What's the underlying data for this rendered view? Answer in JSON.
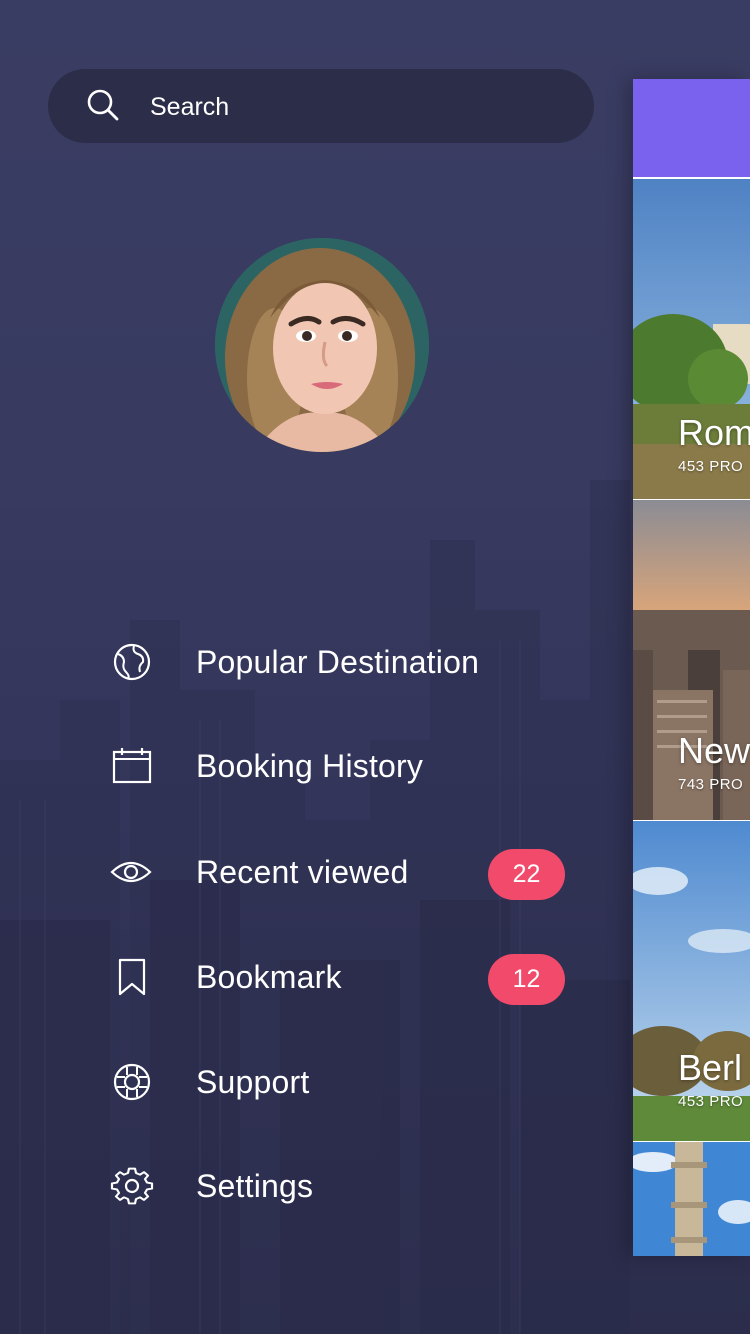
{
  "search": {
    "placeholder": "Search",
    "icon": "search-icon"
  },
  "profile": {
    "avatar_icon": "avatar"
  },
  "menu": {
    "items": [
      {
        "label": "Popular Destination",
        "icon": "globe-icon"
      },
      {
        "label": "Booking History",
        "icon": "calendar-icon"
      },
      {
        "label": "Recent viewed",
        "icon": "eye-icon",
        "badge": "22"
      },
      {
        "label": "Bookmark",
        "icon": "bookmark-icon",
        "badge": "12"
      },
      {
        "label": "Support",
        "icon": "lifebuoy-icon"
      },
      {
        "label": "Settings",
        "icon": "gear-icon"
      }
    ]
  },
  "preview": {
    "header_color": "#7a62ee",
    "cards": [
      {
        "title": "Rom",
        "subtitle": "453 PRO"
      },
      {
        "title": "New",
        "subtitle": "743 PRO"
      },
      {
        "title": "Berl",
        "subtitle": "453 PRO"
      }
    ]
  },
  "colors": {
    "background": "#34365a",
    "search_bg": "#2c2d48",
    "badge": "#f24a6b",
    "accent": "#7a62ee"
  }
}
